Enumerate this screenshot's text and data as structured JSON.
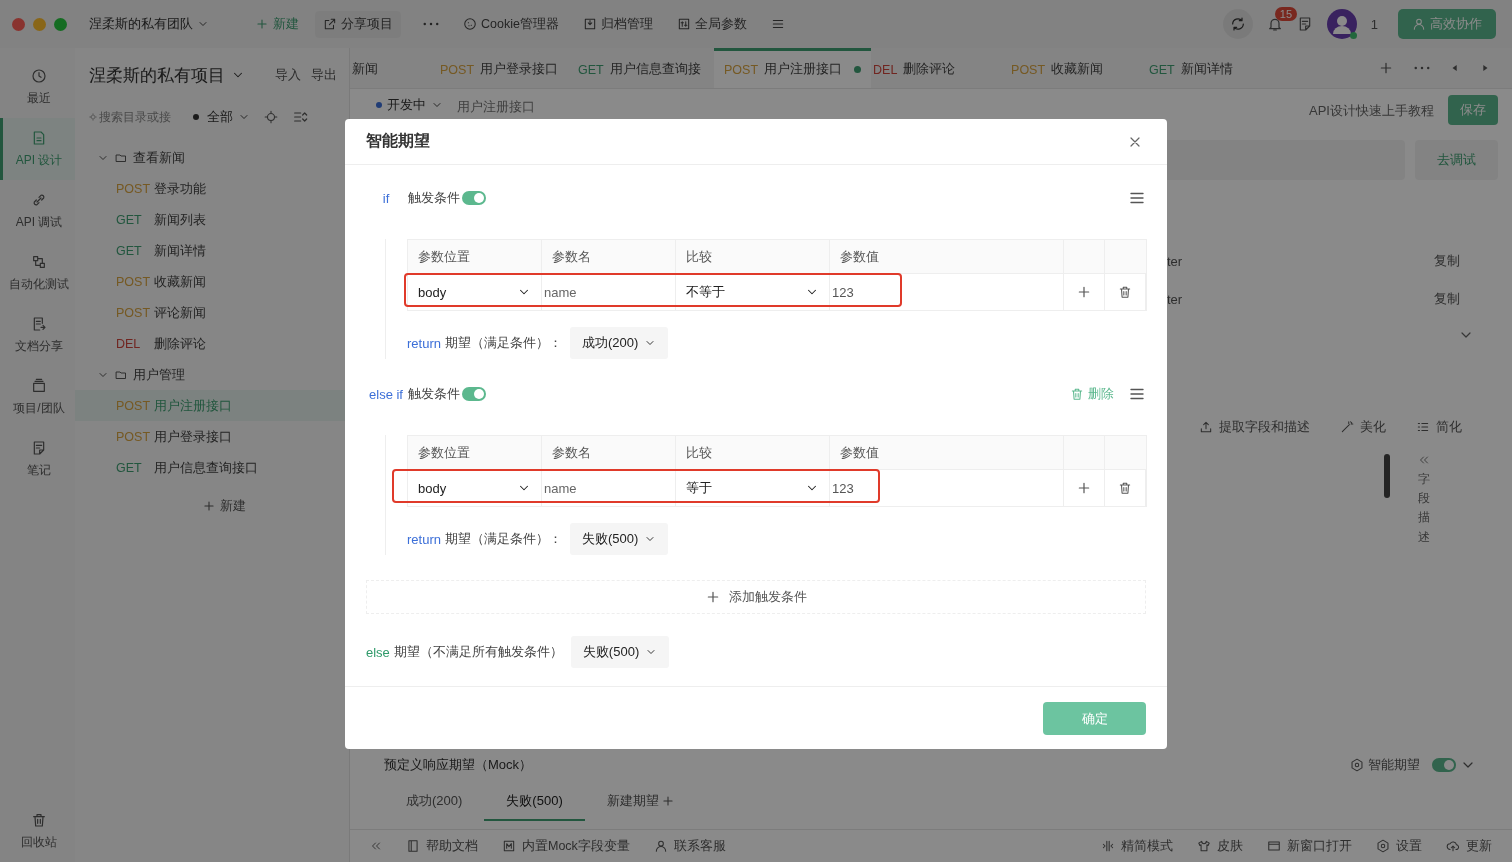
{
  "titlebar": {
    "team": "涅柔斯的私有团队",
    "actions": [
      {
        "kind": "new",
        "label": "新建"
      },
      {
        "kind": "share",
        "label": "分享项目"
      },
      {
        "kind": "more"
      },
      {
        "kind": "cookie",
        "label": "Cookie管理器"
      },
      {
        "kind": "archive",
        "label": "归档管理"
      },
      {
        "kind": "params",
        "label": "全局参数"
      },
      {
        "kind": "menu"
      }
    ],
    "notifications": "15",
    "online_count": "1",
    "collab_button": "高效协作"
  },
  "rail": {
    "items": [
      {
        "kind": "clock",
        "label": "最近",
        "selected": false
      },
      {
        "kind": "doc",
        "label": "API 设计",
        "selected": true
      },
      {
        "kind": "link",
        "label": "API 调试",
        "selected": false
      },
      {
        "kind": "flow",
        "label": "自动化测试",
        "selected": false
      },
      {
        "kind": "sharedoc",
        "label": "文档分享",
        "selected": false
      },
      {
        "kind": "box",
        "label": "项目/团队",
        "selected": false
      },
      {
        "kind": "note",
        "label": "笔记",
        "selected": false
      }
    ],
    "trash": "回收站"
  },
  "tree": {
    "project": "涅柔斯的私有项目",
    "import": "导入",
    "export": "导出",
    "search": {
      "placeholder": "搜索目录或接"
    },
    "filter": "全部",
    "folders": [
      {
        "name": "查看新闻",
        "expanded": true,
        "children": [
          {
            "method": "POST",
            "kind": "post",
            "name": "登录功能",
            "selected": false
          },
          {
            "method": "GET",
            "kind": "get",
            "name": "新闻列表",
            "selected": false
          },
          {
            "method": "GET",
            "kind": "get",
            "name": "新闻详情",
            "selected": false
          },
          {
            "method": "POST",
            "kind": "post",
            "name": "收藏新闻",
            "selected": false
          },
          {
            "method": "POST",
            "kind": "post",
            "name": "评论新闻",
            "selected": false
          },
          {
            "method": "DEL",
            "kind": "del",
            "name": "删除评论",
            "selected": false
          }
        ]
      },
      {
        "name": "用户管理",
        "expanded": true,
        "children": [
          {
            "method": "POST",
            "kind": "post",
            "name": "用户注册接口",
            "selected": true
          },
          {
            "method": "POST",
            "kind": "post",
            "name": "用户登录接口",
            "selected": false
          },
          {
            "method": "GET",
            "kind": "get",
            "name": "用户信息查询接口",
            "selected": false
          }
        ]
      }
    ],
    "new": "新建"
  },
  "tabs": [
    {
      "name": "新闻",
      "selected": false,
      "unsaved": false
    },
    {
      "method": "POST",
      "kind": "post",
      "name": "用户登录接口",
      "selected": false,
      "unsaved": false
    },
    {
      "method": "GET",
      "kind": "get",
      "name": "用户信息查询接",
      "selected": false,
      "unsaved": false
    },
    {
      "method": "POST",
      "kind": "post",
      "name": "用户注册接口",
      "selected": true,
      "unsaved": true
    },
    {
      "method": "DEL",
      "kind": "del",
      "name": "删除评论",
      "selected": false,
      "unsaved": false
    },
    {
      "method": "POST",
      "kind": "post",
      "name": "收藏新闻",
      "selected": false,
      "unsaved": false
    },
    {
      "method": "GET",
      "kind": "get",
      "name": "新闻详情",
      "selected": false,
      "unsaved": false
    }
  ],
  "subbar": {
    "status": "开发中",
    "name": "用户注册接口",
    "tutorial": "API设计快速上手教程",
    "save": "保存",
    "debug": "去调试"
  },
  "param_rows": [
    {
      "text": "ter",
      "action": "复制"
    },
    {
      "text": "ter",
      "action": "复制"
    }
  ],
  "body_tools": [
    {
      "kind": "extract",
      "label": "提取字段和描述"
    },
    {
      "kind": "magic",
      "label": "美化"
    },
    {
      "kind": "short",
      "label": "简化"
    }
  ],
  "side_panel": "字段描述",
  "mock": {
    "title": "预定义响应期望（Mock）",
    "smart_label": "智能期望",
    "smart_on": true,
    "tabs": [
      {
        "label": "成功(200)",
        "selected": false
      },
      {
        "label": "失败(500)",
        "selected": true
      },
      {
        "label": "新建期望",
        "selected": false,
        "kind": "add"
      }
    ]
  },
  "statusbar": {
    "left": [
      {
        "kind": "book",
        "label": "帮助文档"
      },
      {
        "kind": "mbox",
        "label": "内置Mock字段变量"
      },
      {
        "kind": "user",
        "label": "联系客服"
      }
    ],
    "right": [
      {
        "kind": "compact",
        "label": "精简模式"
      },
      {
        "kind": "shirt",
        "label": "皮肤"
      },
      {
        "kind": "window",
        "label": "新窗口打开"
      },
      {
        "kind": "gear",
        "label": "设置"
      },
      {
        "kind": "update",
        "label": "更新"
      }
    ]
  },
  "dialog": {
    "title": "智能期望",
    "conditions": [
      {
        "keyword": "if",
        "label": "触发条件",
        "enabled": true,
        "deletable": false,
        "highlighted": true,
        "columns": [
          "参数位置",
          "参数名",
          "比较",
          "参数值"
        ],
        "row": {
          "location": "body",
          "name": "name",
          "compare": "不等于",
          "value": "123"
        },
        "return_keyword": "return",
        "return_label": "期望（满足条件）：",
        "return_value": "成功(200)"
      },
      {
        "keyword": "else if",
        "label": "触发条件",
        "enabled": true,
        "deletable": true,
        "delete": "删除",
        "highlighted": true,
        "columns": [
          "参数位置",
          "参数名",
          "比较",
          "参数值"
        ],
        "row": {
          "location": "body",
          "name": "name",
          "compare": "等于",
          "value": "123"
        },
        "return_keyword": "return",
        "return_label": "期望（满足条件）：",
        "return_value": "失败(500)"
      }
    ],
    "add_condition": "添加触发条件",
    "else_keyword": "else",
    "else_label": "期望（不满足所有触发条件）",
    "else_value": "失败(500)",
    "confirm": "确定"
  }
}
